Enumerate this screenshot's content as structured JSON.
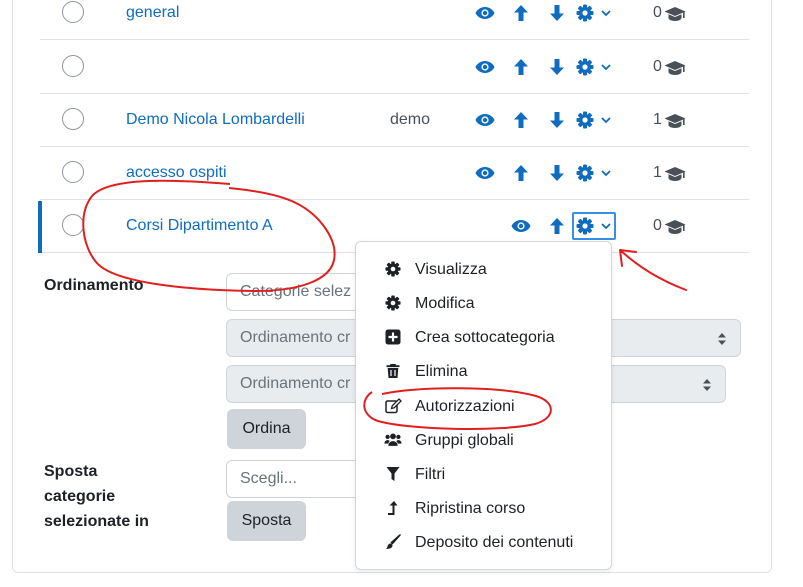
{
  "colors": {
    "link": "#0f6cbf",
    "annotation": "#e02020",
    "focus": "#3a8ee6"
  },
  "categories": [
    {
      "name": "general",
      "idnumber": "",
      "count": "0",
      "show_visibility": true,
      "show_up": true,
      "show_down": true
    },
    {
      "name": "",
      "idnumber": "",
      "count": "0",
      "show_visibility": true,
      "show_up": true,
      "show_down": true
    },
    {
      "name": "Demo Nicola Lombardelli",
      "idnumber": "demo",
      "count": "1",
      "show_visibility": true,
      "show_up": true,
      "show_down": true
    },
    {
      "name": "accesso ospiti",
      "idnumber": "",
      "count": "1",
      "show_visibility": true,
      "show_up": true,
      "show_down": true
    },
    {
      "name": "Corsi Dipartimento A",
      "idnumber": "",
      "count": "0",
      "show_visibility": true,
      "show_up": true,
      "show_down": false
    }
  ],
  "sort_section": {
    "label": "Ordinamento",
    "select1": "Categorie selez",
    "select2": "Ordinamento cr",
    "select3": "Ordinamento cr",
    "button": "Ordina"
  },
  "move_section": {
    "label_line1": "Sposta",
    "label_line2": "categorie",
    "label_line3": "selezionate in",
    "select": "Scegli...",
    "button": "Sposta"
  },
  "action_menu": {
    "items": [
      {
        "label": "Visualizza",
        "icon": "gear-icon"
      },
      {
        "label": "Modifica",
        "icon": "gear-icon"
      },
      {
        "label": "Crea sottocategoria",
        "icon": "plus-square-icon"
      },
      {
        "label": "Elimina",
        "icon": "trash-icon"
      },
      {
        "label": "Autorizzazioni",
        "icon": "edit-icon"
      },
      {
        "label": "Gruppi globali",
        "icon": "users-icon"
      },
      {
        "label": "Filtri",
        "icon": "filter-icon"
      },
      {
        "label": "Ripristina corso",
        "icon": "level-up-icon"
      },
      {
        "label": "Deposito dei contenuti",
        "icon": "paint-brush-icon"
      }
    ]
  }
}
